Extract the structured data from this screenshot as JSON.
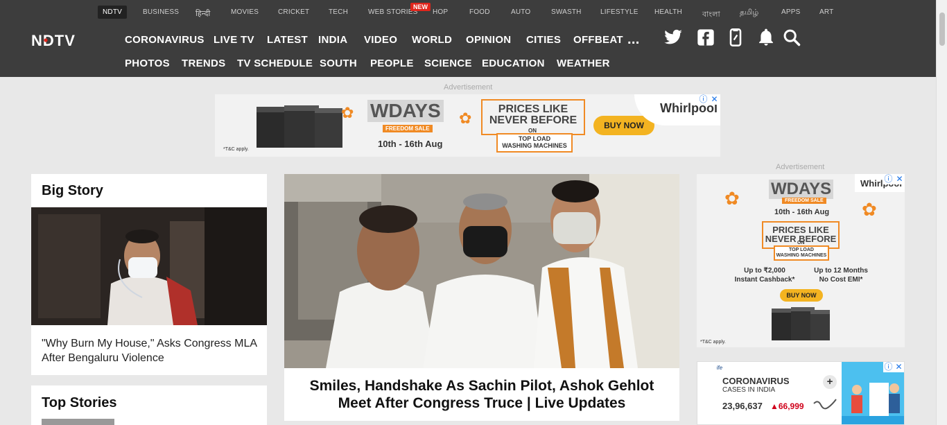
{
  "top_nav": {
    "items": [
      "NDTV",
      "BUSINESS",
      "हिन्दी",
      "MOVIES",
      "CRICKET",
      "TECH",
      "WEB STORIES",
      "HOP",
      "FOOD",
      "AUTO",
      "SWASTH",
      "LIFESTYLE",
      "HEALTH",
      "বাংলা",
      "தமிழ்",
      "APPS",
      "ART"
    ],
    "new_badge": "NEW"
  },
  "brand": {
    "logo_text": "NDTV",
    "accent": "#e1261c"
  },
  "main_nav": {
    "row1": [
      "CORONAVIRUS",
      "LIVE TV",
      "LATEST",
      "INDIA",
      "VIDEO",
      "WORLD",
      "OPINION",
      "CITIES",
      "OFFBEAT"
    ],
    "more": "...",
    "row2": [
      "PHOTOS",
      "TRENDS",
      "TV SCHEDULE",
      "SOUTH",
      "PEOPLE",
      "SCIENCE",
      "EDUCATION",
      "WEATHER"
    ]
  },
  "header_icons": [
    "twitter-icon",
    "facebook-icon",
    "mobile-app-icon",
    "notification-bell-icon",
    "search-icon"
  ],
  "ads": {
    "label": "Advertisement",
    "top": {
      "wdays": "WDAYS",
      "freedom_sale": "FREEDOM SALE",
      "dates": "10th - 16th Aug",
      "prices_line1": "PRICES LIKE",
      "prices_line2": "NEVER BEFORE",
      "on": "ON",
      "top_load": "TOP LOAD",
      "washing": "WASHING MACHINES",
      "buy_now": "BUY NOW",
      "brand": "Whirlpool",
      "tnc": "*T&C apply."
    },
    "side": {
      "wdays": "WDAYS",
      "freedom_sale": "FREEDOM SALE",
      "dates": "10th - 16th Aug",
      "prices_line1": "PRICES LIKE",
      "prices_line2": "NEVER BEFORE",
      "on": "ON",
      "top_load": "TOP LOAD",
      "washing": "WASHING MACHINES",
      "cashback_line1": "Up to ₹2,000",
      "cashback_line2": "Instant Cashback*",
      "emi_line1": "Up to 12 Months",
      "emi_line2": "No Cost EMI*",
      "buy_now": "BUY NOW",
      "brand": "Whirlpool",
      "tnc": "*T&C apply."
    },
    "corona": {
      "sponsor": "SBI Life",
      "title": "CORONAVIRUS",
      "subtitle": "CASES IN INDIA",
      "count": "23,96,637",
      "delta": "▲66,999",
      "expand": "+"
    }
  },
  "big_story": {
    "heading": "Big Story",
    "headline": "\"Why Burn My House,\" Asks Congress MLA After Bengaluru Violence"
  },
  "top_stories": {
    "heading": "Top Stories"
  },
  "main_story": {
    "headline": "Smiles, Handshake As Sachin Pilot, Ashok Gehlot Meet After Congress Truce | Live Updates"
  }
}
